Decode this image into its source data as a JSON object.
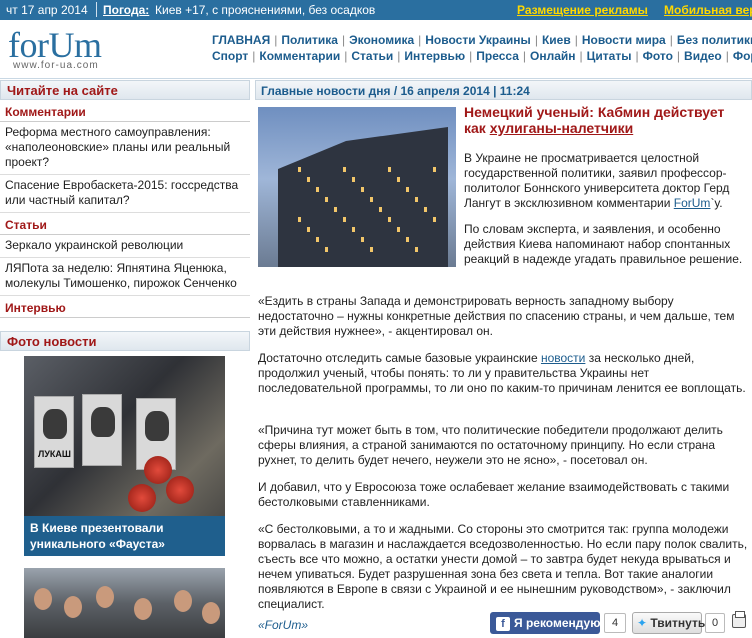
{
  "topbar": {
    "date": "чт 17 апр 2014",
    "weather_label": "Погода:",
    "weather_text": "Киев +17, с прояснениями, без осадков",
    "ad_link": "Размещение рекламы",
    "mobile_link": "Мобильная версия"
  },
  "header": {
    "logo": "forUm",
    "logo_url": "www.for-ua.com",
    "nav_row1": [
      "ГЛАВНАЯ",
      "Политика",
      "Экономика",
      "Новости Украины",
      "Киев",
      "Новости мира",
      "Без политики"
    ],
    "nav_row2": [
      "Спорт",
      "Комментарии",
      "Статьи",
      "Интервью",
      "Пресса",
      "Онлайн",
      "Цитаты",
      "Фото",
      "Видео",
      "Форум"
    ]
  },
  "sidebar": {
    "head": "Читайте на сайте",
    "sections": [
      {
        "title": "Комментарии",
        "items": [
          "Реформа местного самоуправления: «наполеоновские» планы или реальный проект?",
          "Спасение Евробаскета-2015: госсредства или частный капитал?"
        ]
      },
      {
        "title": "Статьи",
        "items": [
          "Зеркало украинской революции",
          "ЛЯПота за неделю: Япнятина Яценюка, молекулы Тимошенко, пирожок Сенченко"
        ]
      },
      {
        "title": "Интервью",
        "items": []
      }
    ],
    "photo_head": "Фото новости",
    "photo1_caption": "В Киеве презентовали уникального «Фауста»",
    "photo1_book_title": "ЛУКАШ"
  },
  "main": {
    "head": "Главные новости дня / 16 апреля 2014 | 11:24",
    "title_part1": "Немецкий ученый: Кабмин действует как ",
    "title_part2": "хулиганы-налетчики",
    "p1_a": "В Украине не просматривается целостной государственной политики, заявил профессор-политолог Боннского университета доктор Герд Лангут в эксклюзивном комментарии ",
    "p1_link": "ForUm",
    "p1_b": "`у.",
    "p2": "По словам эксперта, и заявления, и особенно действия Киева напоминают набор спонтанных реакций в надежде угадать правильное решение.",
    "p3": "«Ездить в страны Запада и демонстрировать верность западному выбору недостаточно – нужны конкретные действия по спасению страны, и чем дальше, тем эти действия нужнее», - акцентировал он.",
    "p4_a": "Достаточно отследить самые базовые украинские ",
    "p4_link": "новости",
    "p4_b": " за несколько дней, продолжил ученый, чтобы понять: то ли у правительства Украины нет последовательной программы, то ли оно по каким-то причинам ленится ее воплощать.",
    "p5": "«Причина тут может быть в том, что политические победители продолжают делить сферы влияния, а страной занимаются по остаточному принципу. Но если страна рухнет, то делить будет нечего, неужели это не ясно», - посетовал он.",
    "p6": "И добавил, что у Евросоюза тоже ослабевает желание взаимодействовать с такими бестолковыми ставленниками.",
    "p7": "«С бестолковыми, а то и жадными. Со стороны это смотрится так: группа молодежи ворвалась в магазин и наслаждается вседозволенностью. Но если пару полок свалить, съесть все что можно, а остатки унести домой – то завтра будет некуда врываться и нечем упиваться. Будет разрушенная зона без света и тепла. Вот такие аналогии появляются в Европе в связи с Украиной и ее нынешним руководством», - заключил специалист.",
    "signature": "«ForUm»"
  },
  "social": {
    "recommend_icon": "f",
    "recommend_label": "Я рекомендую",
    "recommend_count": "4",
    "tweet_label": "Твитнуть",
    "tweet_count": "0"
  }
}
